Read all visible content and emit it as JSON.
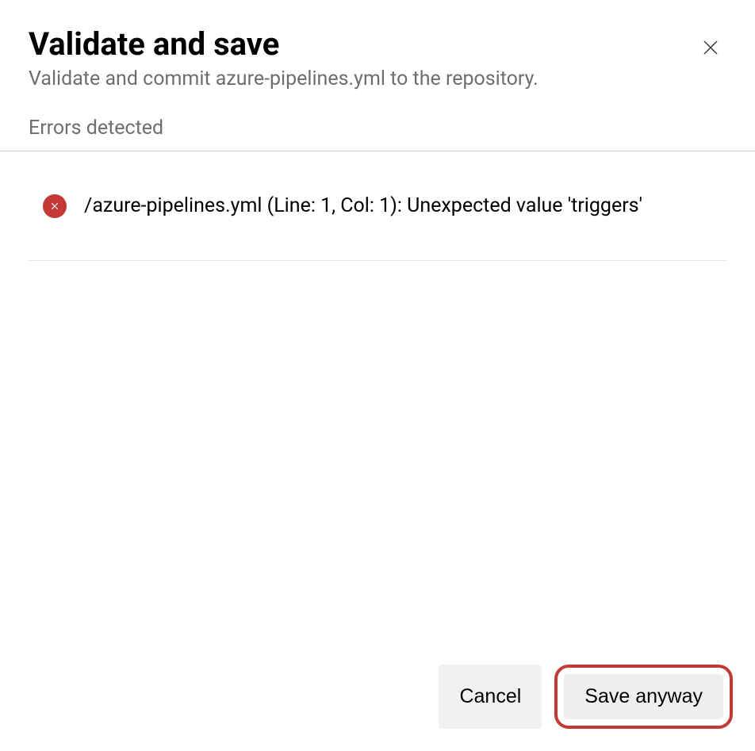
{
  "dialog": {
    "title": "Validate and save",
    "subtitle": "Validate and commit azure-pipelines.yml to the repository."
  },
  "section": {
    "header": "Errors detected"
  },
  "errors": [
    {
      "message": "/azure-pipelines.yml (Line: 1, Col: 1): Unexpected value 'triggers'"
    }
  ],
  "footer": {
    "cancel_label": "Cancel",
    "save_label": "Save anyway"
  }
}
